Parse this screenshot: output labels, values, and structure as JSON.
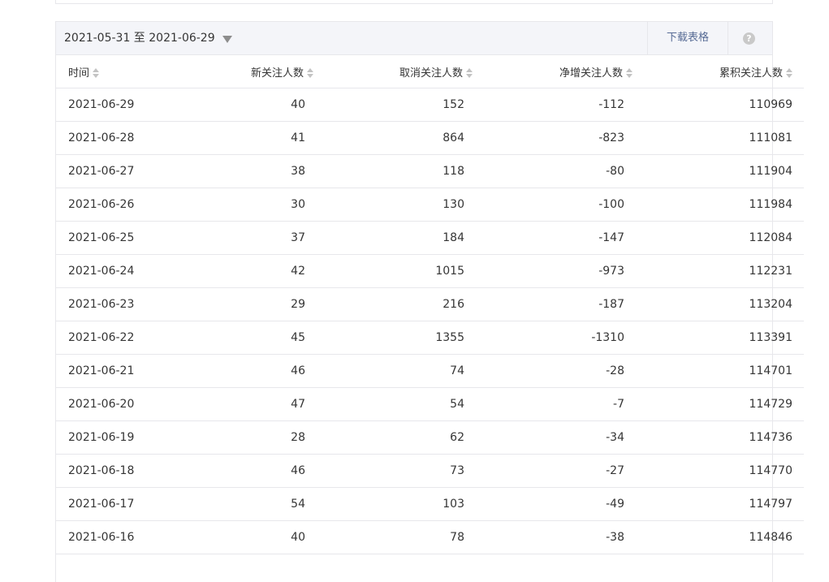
{
  "toolbar": {
    "date_range": "2021-05-31 至 2021-06-29",
    "download_label": "下载表格",
    "help_label": "?"
  },
  "table": {
    "columns": [
      "时间",
      "新关注人数",
      "取消关注人数",
      "净增关注人数",
      "累积关注人数"
    ],
    "rows": [
      [
        "2021-06-29",
        "40",
        "152",
        "-112",
        "110969"
      ],
      [
        "2021-06-28",
        "41",
        "864",
        "-823",
        "111081"
      ],
      [
        "2021-06-27",
        "38",
        "118",
        "-80",
        "111904"
      ],
      [
        "2021-06-26",
        "30",
        "130",
        "-100",
        "111984"
      ],
      [
        "2021-06-25",
        "37",
        "184",
        "-147",
        "112084"
      ],
      [
        "2021-06-24",
        "42",
        "1015",
        "-973",
        "112231"
      ],
      [
        "2021-06-23",
        "29",
        "216",
        "-187",
        "113204"
      ],
      [
        "2021-06-22",
        "45",
        "1355",
        "-1310",
        "113391"
      ],
      [
        "2021-06-21",
        "46",
        "74",
        "-28",
        "114701"
      ],
      [
        "2021-06-20",
        "47",
        "54",
        "-7",
        "114729"
      ],
      [
        "2021-06-19",
        "28",
        "62",
        "-34",
        "114736"
      ],
      [
        "2021-06-18",
        "46",
        "73",
        "-27",
        "114770"
      ],
      [
        "2021-06-17",
        "54",
        "103",
        "-49",
        "114797"
      ],
      [
        "2021-06-16",
        "40",
        "78",
        "-38",
        "114846"
      ]
    ]
  },
  "colors": {
    "toolbar_bg": "#f4f5f9",
    "border": "#e7e7eb",
    "link": "#576b95",
    "text": "#353535"
  }
}
